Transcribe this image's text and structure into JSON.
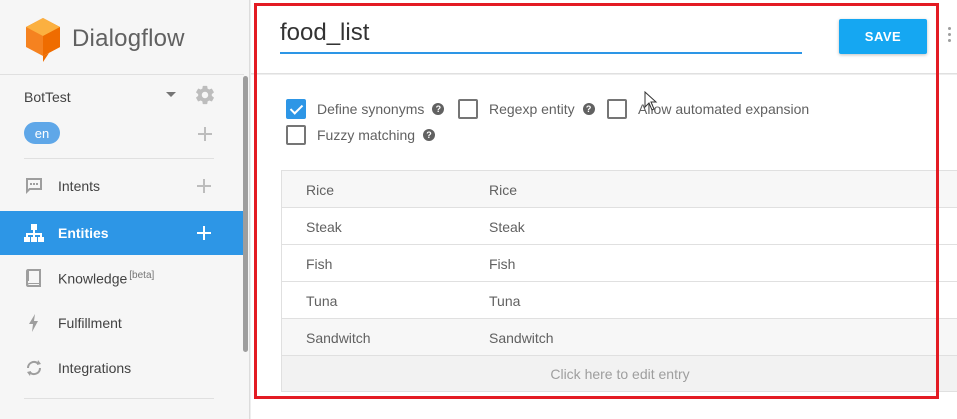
{
  "app": {
    "logo_text": "Dialogflow",
    "accent_color": "#2d96e6",
    "logo_color": "#f58220"
  },
  "sidebar": {
    "agent_name": "BotTest",
    "language": "en",
    "items": [
      {
        "label": "Intents",
        "icon": "chat-bubble-icon",
        "active": false,
        "has_add": true
      },
      {
        "label": "Entities",
        "icon": "hierarchy-icon",
        "active": true,
        "has_add": true
      },
      {
        "label": "Knowledge",
        "badge": "[beta]",
        "icon": "book-icon",
        "active": false,
        "has_add": false
      },
      {
        "label": "Fulfillment",
        "icon": "lightning-icon",
        "active": false,
        "has_add": false
      },
      {
        "label": "Integrations",
        "icon": "sync-icon",
        "active": false,
        "has_add": false
      }
    ]
  },
  "entity": {
    "name": "food_list",
    "save_label": "SAVE",
    "options": {
      "define_synonyms": {
        "label": "Define synonyms",
        "checked": true
      },
      "regexp_entity": {
        "label": "Regexp entity",
        "checked": false
      },
      "automated_expansion": {
        "label": "Allow automated expansion",
        "checked": false
      },
      "fuzzy_matching": {
        "label": "Fuzzy matching",
        "checked": false
      }
    },
    "entries": [
      {
        "value": "Rice",
        "synonyms": "Rice"
      },
      {
        "value": "Steak",
        "synonyms": "Steak"
      },
      {
        "value": "Fish",
        "synonyms": "Fish"
      },
      {
        "value": "Tuna",
        "synonyms": "Tuna"
      },
      {
        "value": "Sandwitch",
        "synonyms": "Sandwitch"
      }
    ],
    "edit_hint": "Click here to edit entry"
  }
}
